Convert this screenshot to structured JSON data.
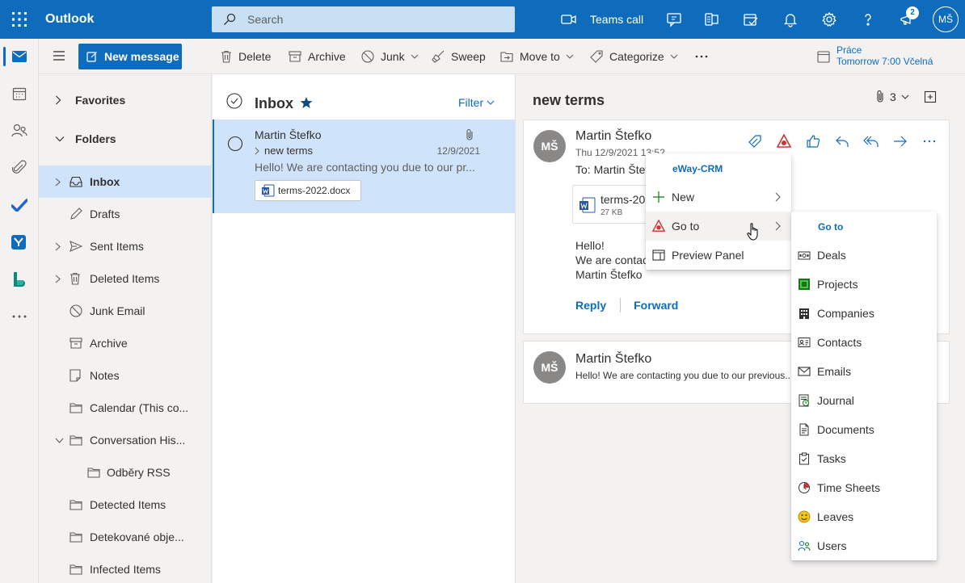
{
  "app": {
    "title": "Outlook"
  },
  "search": {
    "placeholder": "Search"
  },
  "topbar": {
    "teams_call": "Teams call",
    "notification_count": "2",
    "user_initials": "MŠ"
  },
  "command_bar": {
    "new_message": "New message",
    "delete": "Delete",
    "archive": "Archive",
    "junk": "Junk",
    "sweep": "Sweep",
    "move_to": "Move to",
    "categorize": "Categorize",
    "more": "...",
    "calendar_event_title": "Práce",
    "calendar_event_time": "Tomorrow 7:00 Včelná"
  },
  "folders": {
    "favorites": "Favorites",
    "folders": "Folders",
    "items": [
      {
        "label": "Inbox"
      },
      {
        "label": "Drafts"
      },
      {
        "label": "Sent Items"
      },
      {
        "label": "Deleted Items"
      },
      {
        "label": "Junk Email"
      },
      {
        "label": "Archive"
      },
      {
        "label": "Notes"
      },
      {
        "label": "Calendar (This co..."
      },
      {
        "label": "Conversation His..."
      },
      {
        "label": "Odběry RSS"
      },
      {
        "label": "Detected Items"
      },
      {
        "label": "Detekované obje..."
      },
      {
        "label": "Infected Items"
      }
    ]
  },
  "message_list": {
    "title": "Inbox",
    "filter": "Filter",
    "messages": [
      {
        "from": "Martin Štefko",
        "subject": "new terms",
        "date": "12/9/2021",
        "preview": "Hello! We are contacting you due to our pr...",
        "attachment": "terms-2022.docx"
      }
    ]
  },
  "reading": {
    "subject": "new terms",
    "attachment_count": "3",
    "messages": [
      {
        "initials": "MŠ",
        "from": "Martin Štefko",
        "date": "Thu 12/9/2021 13:52",
        "to": "To: Martin Štefko",
        "attachment_name": "terms-20",
        "attachment_size": "27 KB",
        "body_line1": "Hello!",
        "body_line2": "We are contact",
        "body_line3": "Martin Štefko",
        "reply": "Reply",
        "forward": "Forward"
      },
      {
        "initials": "MŠ",
        "from": "Martin Štefko",
        "preview": "Hello! We are contacting you due to our previous..."
      }
    ]
  },
  "eway_menu": {
    "header": "eWay-CRM",
    "items": [
      {
        "label": "New"
      },
      {
        "label": "Go to"
      },
      {
        "label": "Preview Panel"
      }
    ]
  },
  "goto_menu": {
    "header": "Go to",
    "items": [
      {
        "label": "Deals"
      },
      {
        "label": "Projects"
      },
      {
        "label": "Companies"
      },
      {
        "label": "Contacts"
      },
      {
        "label": "Emails"
      },
      {
        "label": "Journal"
      },
      {
        "label": "Documents"
      },
      {
        "label": "Tasks"
      },
      {
        "label": "Time Sheets"
      },
      {
        "label": "Leaves"
      },
      {
        "label": "Users"
      }
    ]
  },
  "colors": {
    "brand": "#0f6cbd",
    "selected": "#cfe4fa",
    "pane": "#f3f2f1"
  }
}
